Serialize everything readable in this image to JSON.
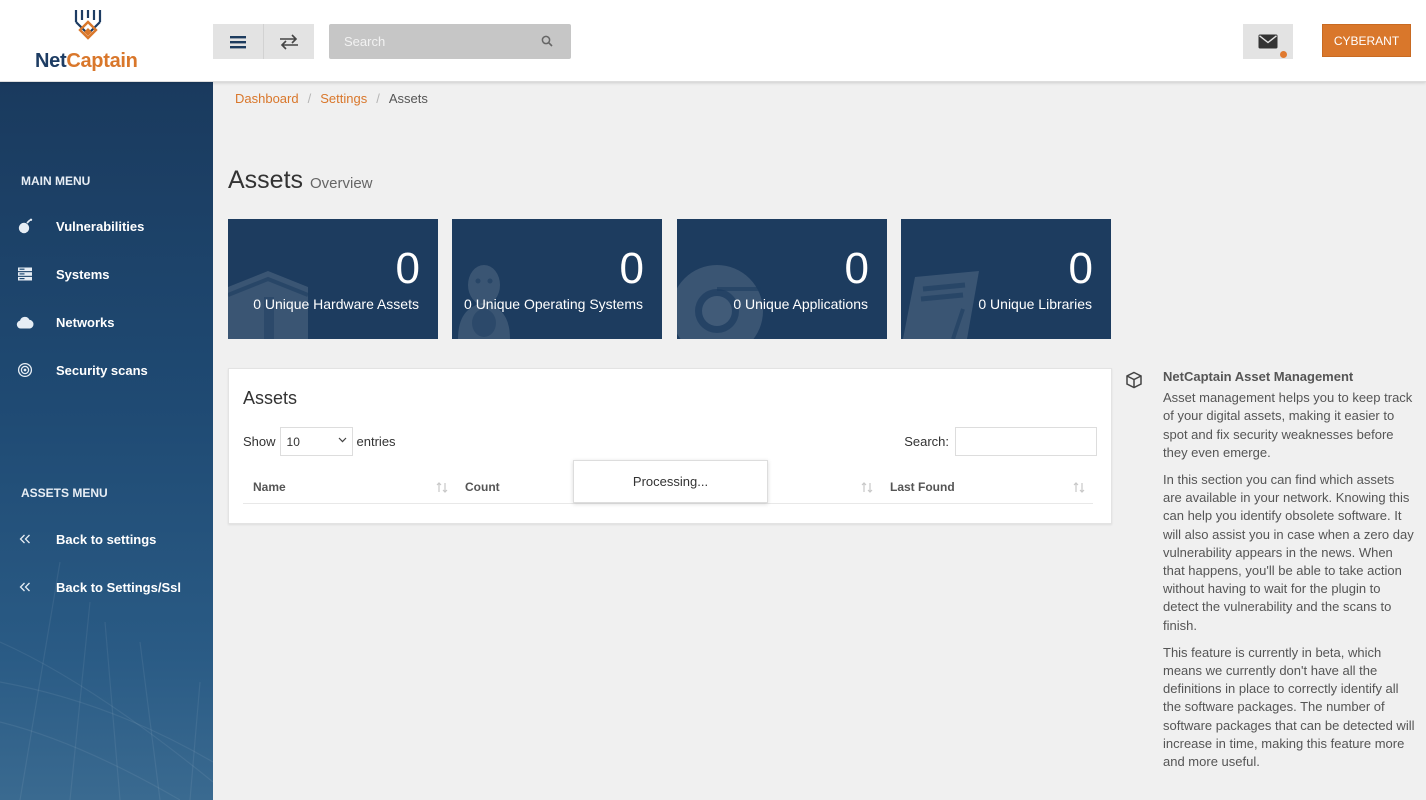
{
  "brand": {
    "name_part1": "Net",
    "name_part2": "Captain"
  },
  "header": {
    "search_placeholder": "Search",
    "user_label": "CYBERANT",
    "icons": [
      "menu-icon",
      "swap-icon",
      "search-icon",
      "mail-icon"
    ]
  },
  "sidebar": {
    "main_menu_label": "MAIN MENU",
    "main_items": [
      {
        "label": "Vulnerabilities",
        "icon": "bomb-icon"
      },
      {
        "label": "Systems",
        "icon": "server-icon"
      },
      {
        "label": "Networks",
        "icon": "cloud-icon"
      },
      {
        "label": "Security scans",
        "icon": "target-icon"
      }
    ],
    "assets_menu_label": "ASSETS MENU",
    "assets_items": [
      {
        "label": "Back to settings",
        "icon": "double-chevron-left-icon"
      },
      {
        "label": "Back to Settings/Ssl",
        "icon": "double-chevron-left-icon"
      }
    ]
  },
  "breadcrumb": {
    "items": [
      "Dashboard",
      "Settings"
    ],
    "current": "Assets"
  },
  "page": {
    "title": "Assets",
    "subtitle": "Overview"
  },
  "stats": [
    {
      "value": "0",
      "label": "0 Unique Hardware Assets",
      "icon": "box-icon"
    },
    {
      "value": "0",
      "label": "0 Unique Operating Systems",
      "icon": "linux-icon"
    },
    {
      "value": "0",
      "label": "0 Unique Applications",
      "icon": "chrome-icon"
    },
    {
      "value": "0",
      "label": "0 Unique Libraries",
      "icon": "book-icon"
    }
  ],
  "assets_table": {
    "title": "Assets",
    "show_label": "Show",
    "entries_label": "entries",
    "page_size": "10",
    "search_label": "Search:",
    "columns": [
      "Name",
      "Count",
      "Last Found"
    ],
    "processing_text": "Processing..."
  },
  "info": {
    "title": "NetCaptain Asset Management",
    "paragraphs": [
      "Asset management helps you to keep track of your digital assets, making it easier to spot and fix security weaknesses before they even emerge.",
      "In this section you can find which assets are available in your network. Knowing this can help you identify obsolete software. It will also assist you in case when a zero day vulnerability appears in the news. When that happens, you'll be able to take action without having to wait for the plugin to detect the vulnerability and the scans to finish.",
      "This feature is currently in beta, which means we currently don't have all the definitions in place to correctly identify all the software packages. The number of software packages that can be detected will increase in time, making this feature more and more useful."
    ]
  },
  "colors": {
    "accent": "#d9772b",
    "navy": "#1d3c5f",
    "sidebar": "#1f4a73"
  }
}
